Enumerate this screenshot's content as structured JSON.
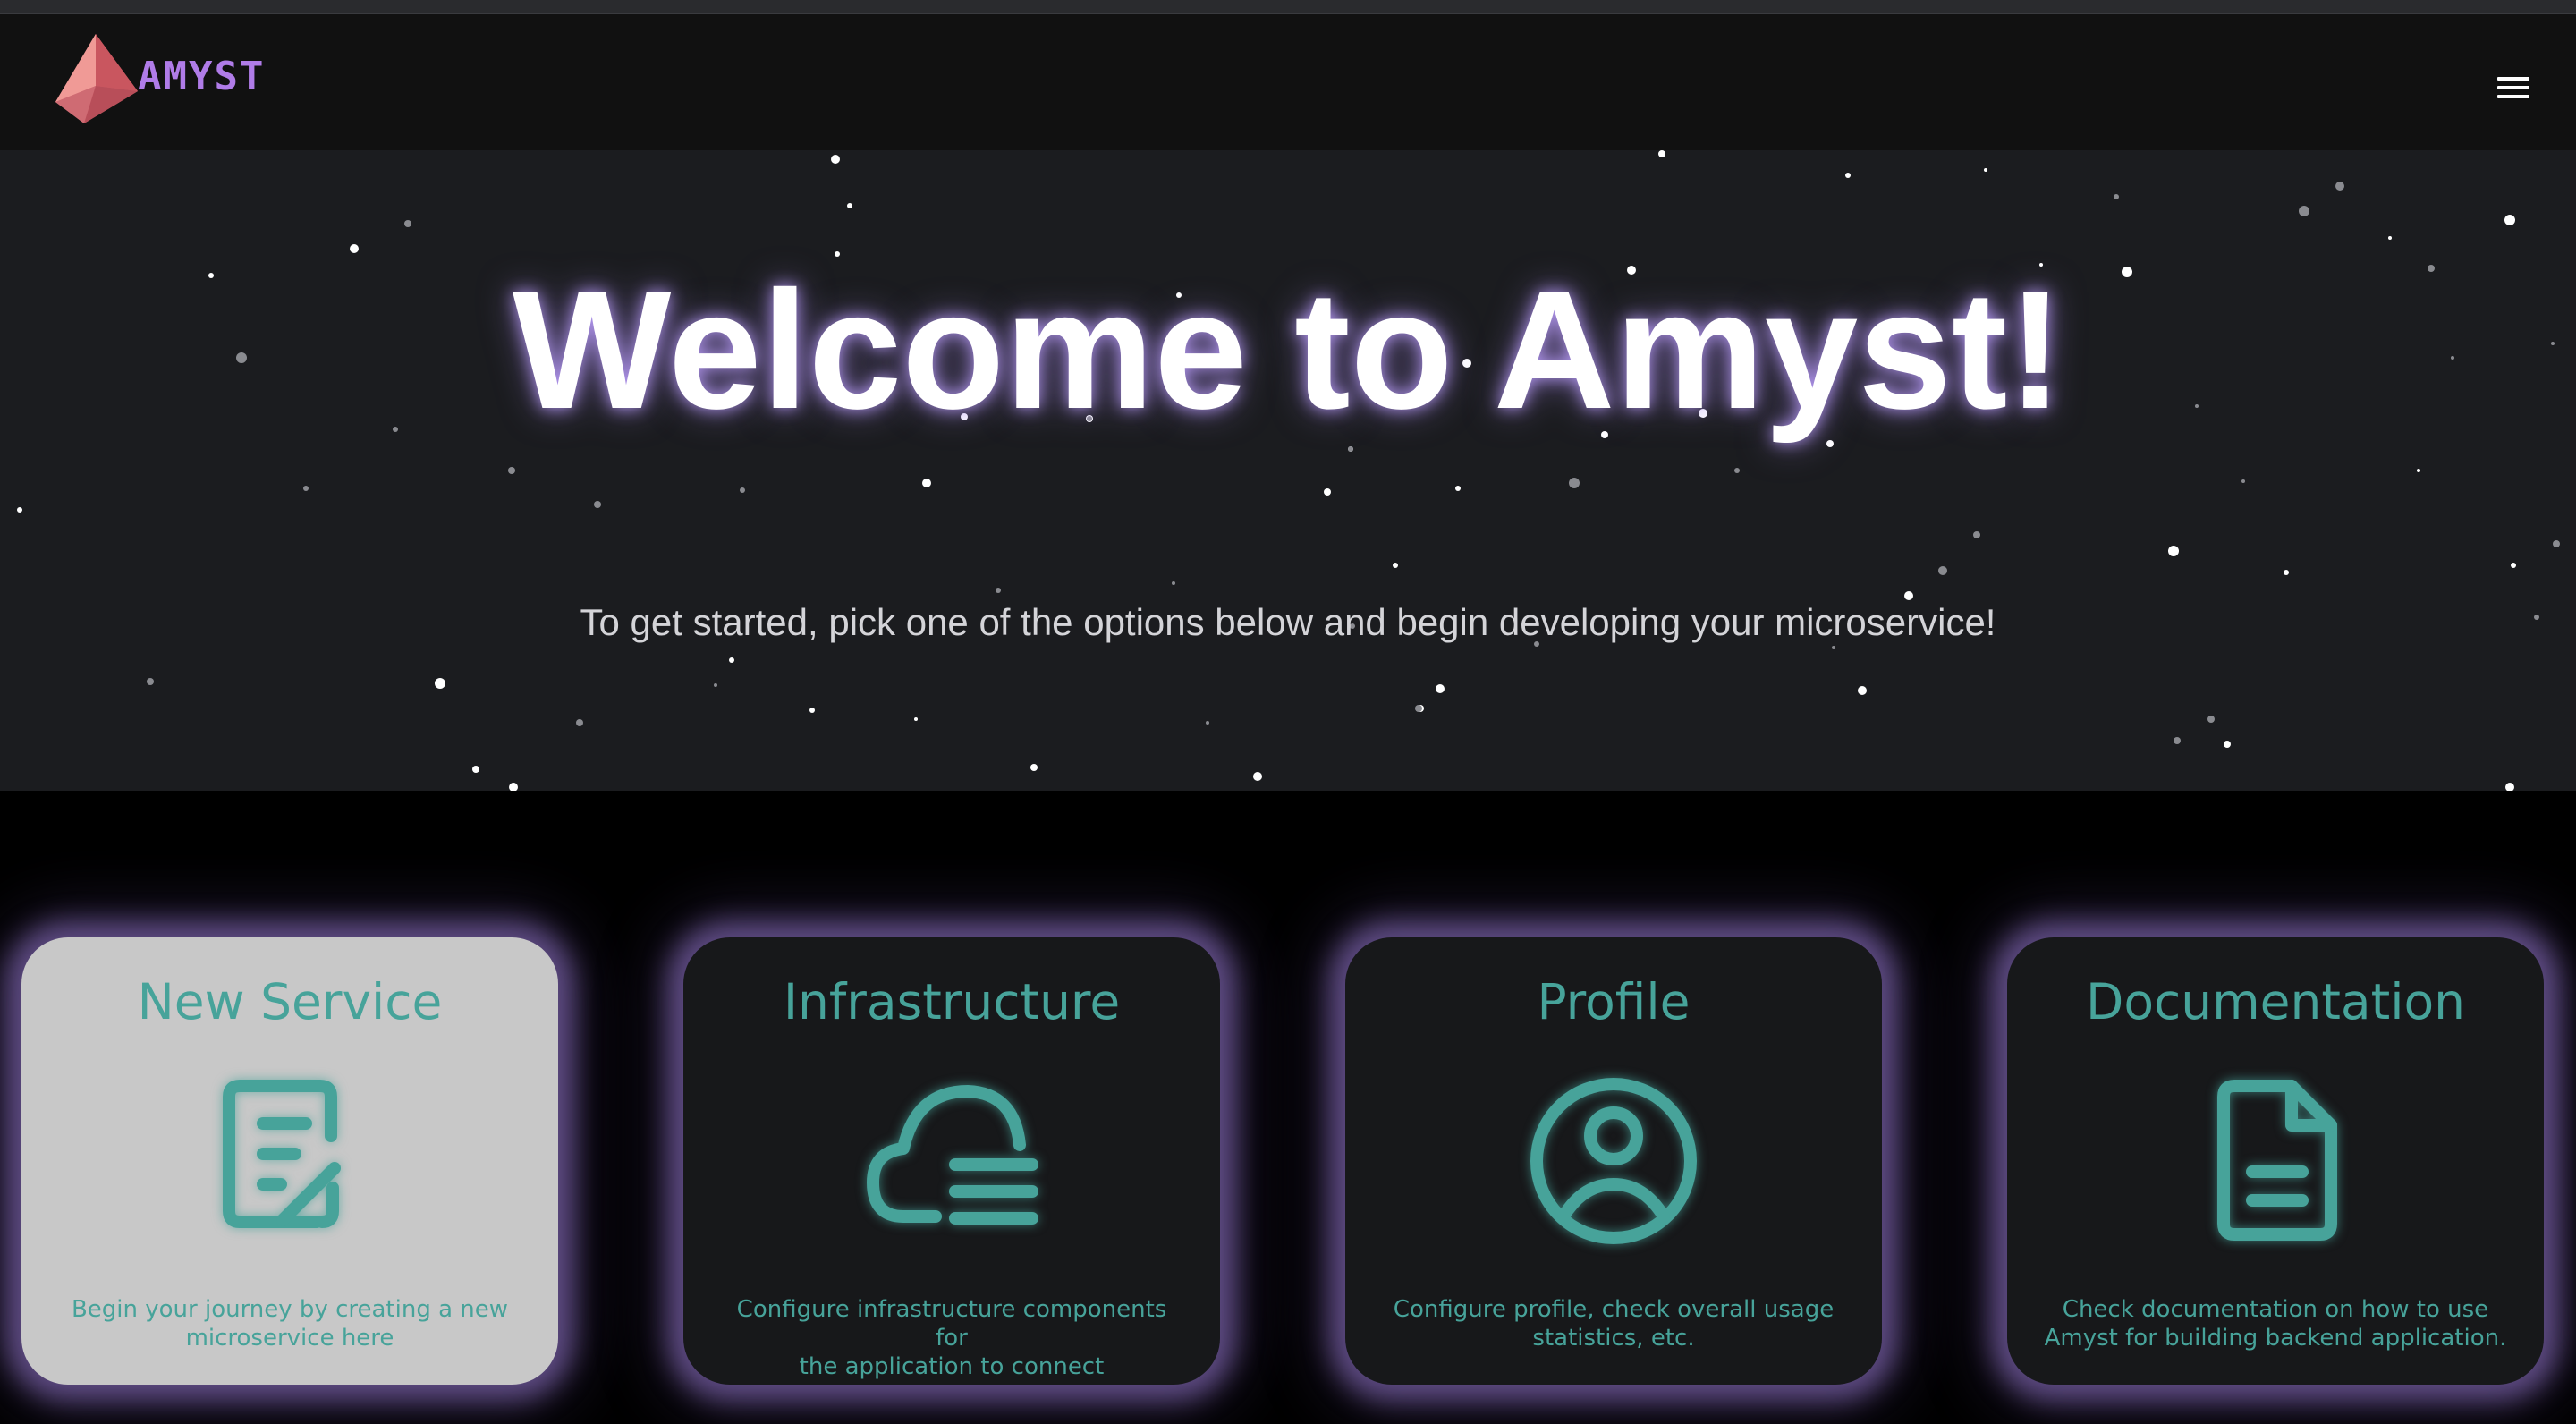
{
  "header": {
    "brand": "AMYST",
    "menu_icon": "hamburger-menu-icon"
  },
  "hero": {
    "title": "Welcome to Amyst!",
    "subtitle": "To get started, pick one of the options below and begin developing your microservice!"
  },
  "colors": {
    "accent_teal": "#47a39a",
    "brand_purple": "#b07ce8",
    "glow_purple": "#9678cd",
    "hero_bg": "#1b1c1f",
    "card_bg": "#17181a",
    "card_active_bg": "#c8c8c8"
  },
  "cards": [
    {
      "title": "New Service",
      "icon": "document-edit-icon",
      "desc_line1": "Begin your journey by creating a new",
      "desc_line2": "microservice here",
      "active": true
    },
    {
      "title": "Infrastructure",
      "icon": "cloud-list-icon",
      "desc_line1": "Configure infrastructure components for",
      "desc_line2": "the application to connect",
      "active": false
    },
    {
      "title": "Profile",
      "icon": "user-circle-icon",
      "desc_line1": "Configure profile, check overall usage",
      "desc_line2": "statistics, etc.",
      "active": false
    },
    {
      "title": "Documentation",
      "icon": "file-text-icon",
      "desc_line1": "Check documentation on how to use",
      "desc_line2": "Amyst for building backend application.",
      "active": false
    }
  ]
}
